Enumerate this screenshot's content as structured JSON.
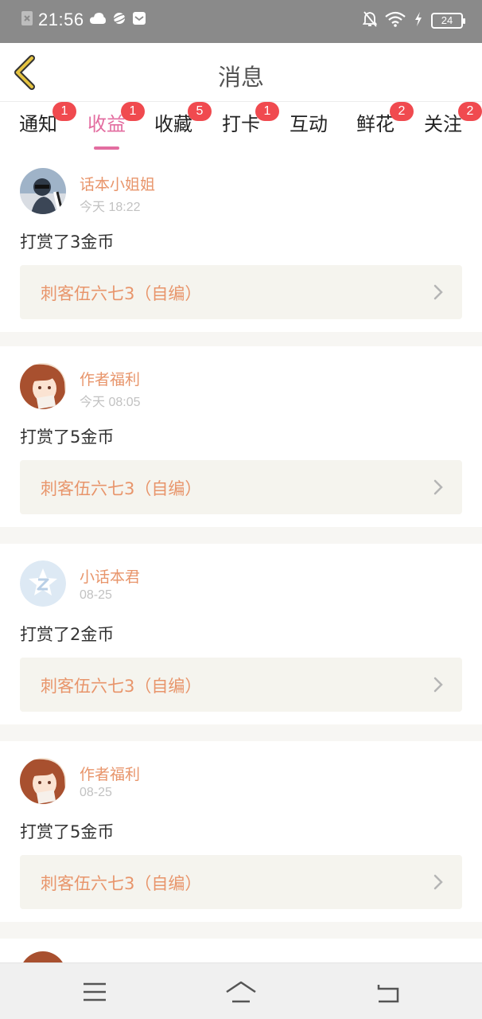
{
  "status_bar": {
    "time": "21:56",
    "battery": "24",
    "icons": [
      "close-box-icon",
      "cloud-icon",
      "planet-icon",
      "mail-icon",
      "bell-off-icon",
      "wifi-icon",
      "charging-icon",
      "battery-icon"
    ]
  },
  "header": {
    "title": "消息",
    "back_icon": "back-chevron-icon"
  },
  "tabs": [
    {
      "label": "通知",
      "badge": "1",
      "active": false
    },
    {
      "label": "收益",
      "badge": "1",
      "active": true
    },
    {
      "label": "收藏",
      "badge": "5",
      "active": false
    },
    {
      "label": "打卡",
      "badge": "1",
      "active": false
    },
    {
      "label": "互动",
      "badge": "",
      "active": false
    },
    {
      "label": "鲜花",
      "badge": "2",
      "active": false
    },
    {
      "label": "关注",
      "badge": "2",
      "active": false
    }
  ],
  "messages": [
    {
      "sender": "话本小姐姐",
      "time": "今天 18:22",
      "text": "打赏了3金币",
      "work": "刺客伍六七3（自编）",
      "avatar_icon": "avatar-photo"
    },
    {
      "sender": "作者福利",
      "time": "今天 08:05",
      "text": "打赏了5金币",
      "work": "刺客伍六七3（自编）",
      "avatar_icon": "avatar-anime-girl"
    },
    {
      "sender": "小话本君",
      "time": "08-25",
      "text": "打赏了2金币",
      "work": "刺客伍六七3（自编）",
      "avatar_icon": "avatar-logo-z"
    },
    {
      "sender": "作者福利",
      "time": "08-25",
      "text": "打赏了5金币",
      "work": "刺客伍六七3（自编）",
      "avatar_icon": "avatar-anime-girl"
    }
  ],
  "nav": {
    "icons": [
      "menu-icon",
      "home-icon",
      "back-icon"
    ]
  },
  "colors": {
    "accent": "#e36da0",
    "name": "#e8956b",
    "badge": "#f04a4f",
    "link_bg": "#f5f4ee",
    "back_arrow": "#e5c341"
  }
}
